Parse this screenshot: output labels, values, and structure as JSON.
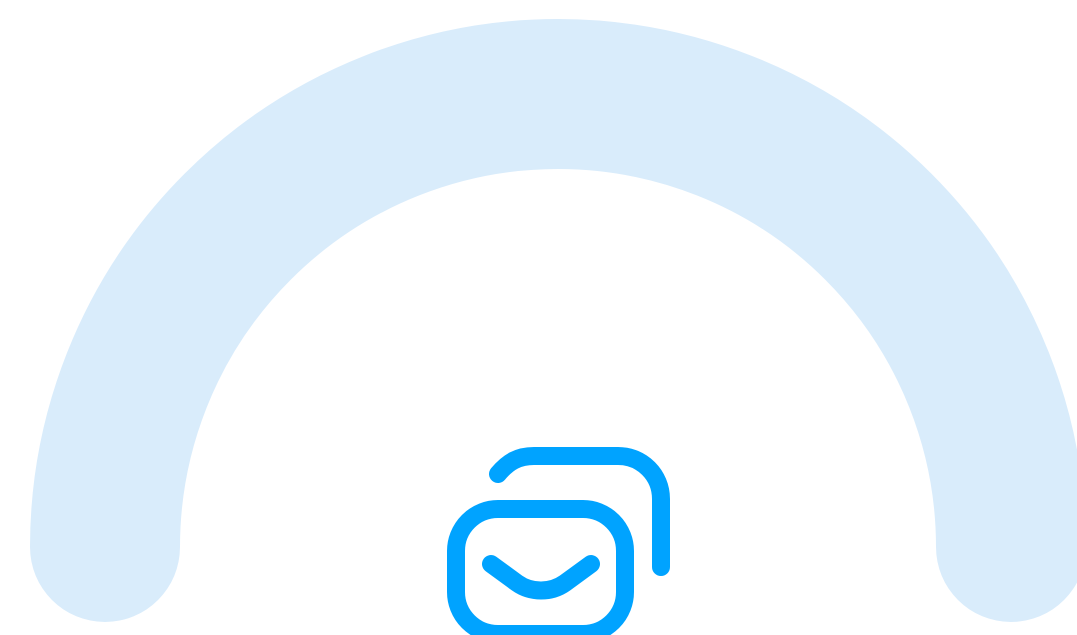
{
  "illustration": {
    "background_color": "#ffffff",
    "arc_color": "#d9ecfb",
    "icon_color": "#00a3ff",
    "icon_name": "messages-icon"
  }
}
